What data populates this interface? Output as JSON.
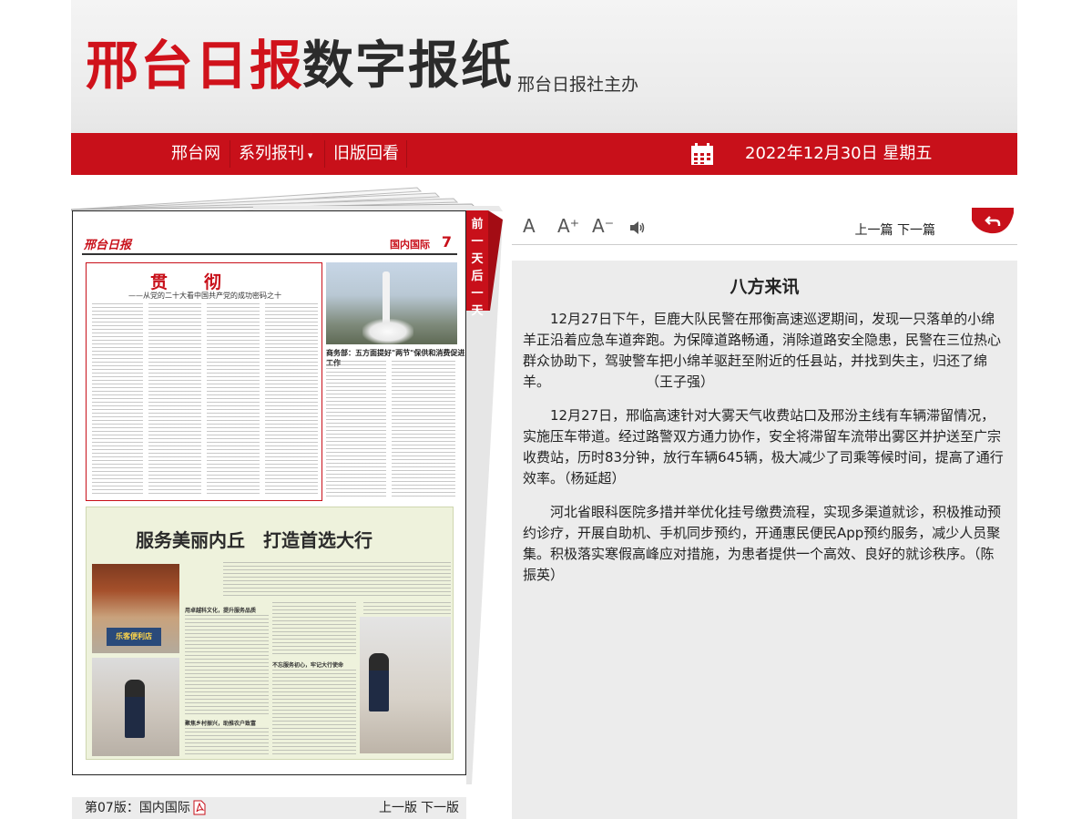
{
  "header": {
    "title_red": "邢台日报",
    "title_dark": "数字报纸",
    "subtitle": "邢台日报社主办"
  },
  "nav": {
    "items": [
      "邢台网",
      "系列报刊",
      "旧版回看"
    ],
    "dropdown_marker": "▾",
    "date": "2022年12月30日 星期五"
  },
  "side_tab": [
    "前",
    "一",
    "天",
    "后",
    "一",
    "天"
  ],
  "toolbar": {
    "font_large": "A",
    "font_up": "A⁺",
    "font_down": "A⁻",
    "prev_article": "上一篇",
    "next_article": "下一篇"
  },
  "article": {
    "title": "八方来讯",
    "paragraphs": [
      "12月27日下午，巨鹿大队民警在邢衡高速巡逻期间，发现一只落单的小绵羊正沿着应急车道奔跑。为保障道路畅通，消除道路安全隐患，民警在三位热心群众协助下，驾驶警车把小绵羊驱赶至附近的任县站，并找到失主，归还了绵羊。　　　　　　　　（王子强）",
      "12月27日，邢临高速针对大雾天气收费站口及邢汾主线有车辆滞留情况，实施压车带道。经过路警双方通力协作，安全将滞留车流带出雾区并护送至广宗收费站，历时83分钟，放行车辆645辆，极大减少了司乘等候时间，提高了通行效率。（杨延超）",
      "河北省眼科医院多措并举优化挂号缴费流程，实现多渠道就诊，积极推动预约诊疗，开展自助机、手机同步预约，开通惠民便民App预约服务，减少人员聚集。积极落实寒假高峰应对措施，为患者提供一个高效、良好的就诊秩序。（陈振英）"
    ]
  },
  "page_footer": {
    "page_label": "第07版：国内国际",
    "prev_page": "上一版",
    "next_page": "下一版"
  },
  "newspaper": {
    "logo": "邢台日报",
    "section": "国内国际",
    "page_no": "7",
    "headline": "贯彻",
    "subheadline": "——从党的二十大看中国共产党的成功密码之十",
    "side_headline": "商务部：五方面提好\"两节\"保供和消费促进工作",
    "ad_title": "服务美丽内丘　打造首选大行",
    "store_sign": "乐客便利店",
    "caption_1": "用卓越科文化，提升服务品质",
    "caption_2": "不忘服务初心，牢记大行使命",
    "caption_3": "聚焦乡村振兴，助推农户致富"
  },
  "colors": {
    "brand_red": "#c8101a",
    "article_bg": "#ececec"
  },
  "icons": {
    "calendar": "calendar-icon",
    "speaker": "speaker-icon",
    "back": "back-arrow-icon",
    "pdf": "pdf-icon"
  }
}
